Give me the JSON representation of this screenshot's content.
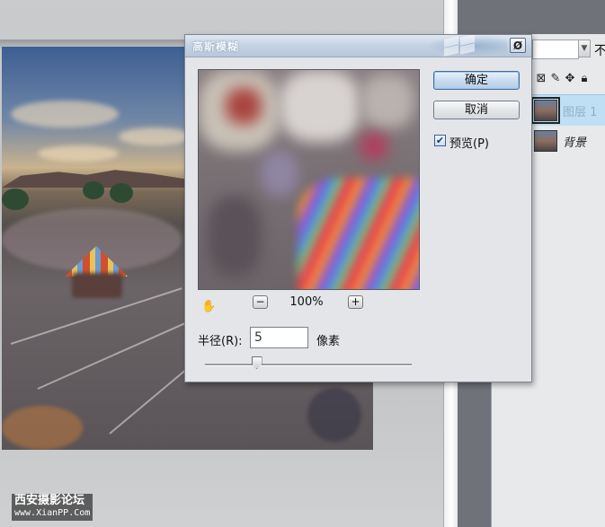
{
  "dialog": {
    "title": "高斯模糊",
    "close_icon": "close-icon",
    "ok_label": "确定",
    "cancel_label": "取消",
    "preview_checkbox_checked": true,
    "preview_label": "预览(P)",
    "zoom_out_label": "−",
    "zoom_in_label": "+",
    "zoom_level": "100%",
    "hand_icon": "hand-icon",
    "radius_label": "半径(R):",
    "radius_value": "5",
    "radius_unit": "像素",
    "radius_slider_fraction": 0.25
  },
  "layers_panel": {
    "opacity_label": "不",
    "lock_icons": [
      "transparency-lock-icon",
      "brush-icon",
      "move-icon",
      "lock-icon"
    ],
    "layers": [
      {
        "name": "图层 1",
        "selected": true
      },
      {
        "name": "背景",
        "selected": false
      }
    ]
  },
  "watermark": {
    "line1": "西安摄影论坛",
    "line2": "www.XianPP.Com"
  },
  "colors": {
    "selected_layer": "#bfe0f4",
    "ok_button": "#c9dcf0",
    "dialog_bg": "#e3e5e8"
  }
}
